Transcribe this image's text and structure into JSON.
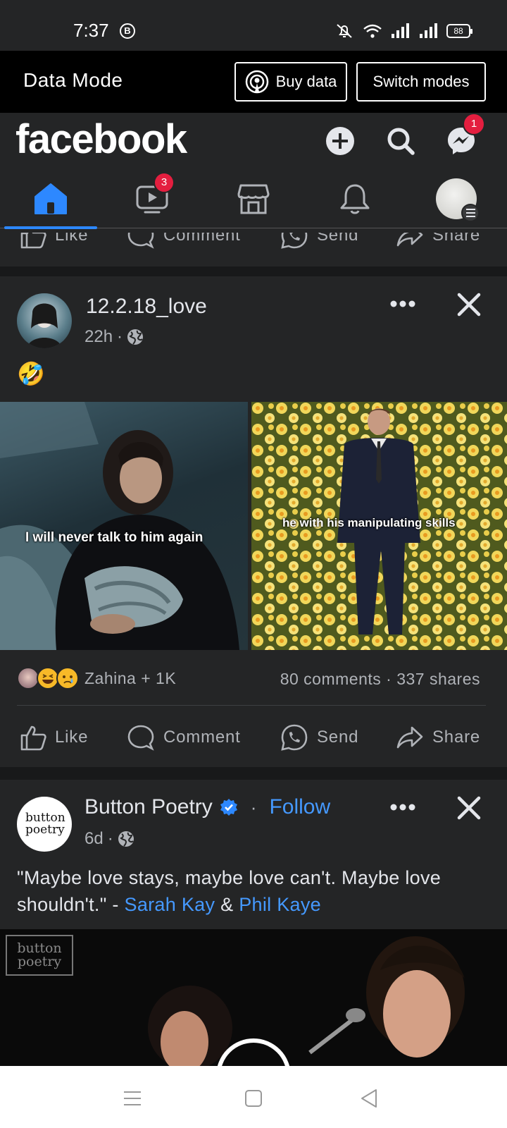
{
  "status": {
    "time": "7:37",
    "b_badge": "B",
    "battery": "88"
  },
  "data_mode": {
    "title": "Data Mode",
    "buy_label": "Buy data",
    "switch_label": "Switch modes"
  },
  "header": {
    "logo": "facebook",
    "messenger_badge": "1",
    "video_badge": "3"
  },
  "prev_actions": {
    "like": "Like",
    "comment": "Comment",
    "send": "Send",
    "share": "Share"
  },
  "post1": {
    "author": "12.2.18_love",
    "time": "22h",
    "text_emoji": "🤣",
    "images": [
      {
        "caption": "I will never talk to him again"
      },
      {
        "caption": "he with his manipulating skills"
      }
    ],
    "reactions_text": "Zahina + 1K",
    "stats": "80 comments · 337 shares",
    "actions": {
      "like": "Like",
      "comment": "Comment",
      "send": "Send",
      "share": "Share"
    }
  },
  "post2": {
    "author": "Button Poetry",
    "follow": "Follow",
    "time": "6d",
    "text_main": "\"Maybe love stays, maybe love can't. Maybe love shouldn't.\" - ",
    "link1": "Sarah Kay",
    "amp": " & ",
    "link2": "Phil Kaye",
    "avatar_text": "button poetry",
    "watermark": "button poetry"
  },
  "colors": {
    "accent": "#2d88ff",
    "badge": "#e41e3f",
    "link": "#4599ff",
    "background": "#242526"
  }
}
